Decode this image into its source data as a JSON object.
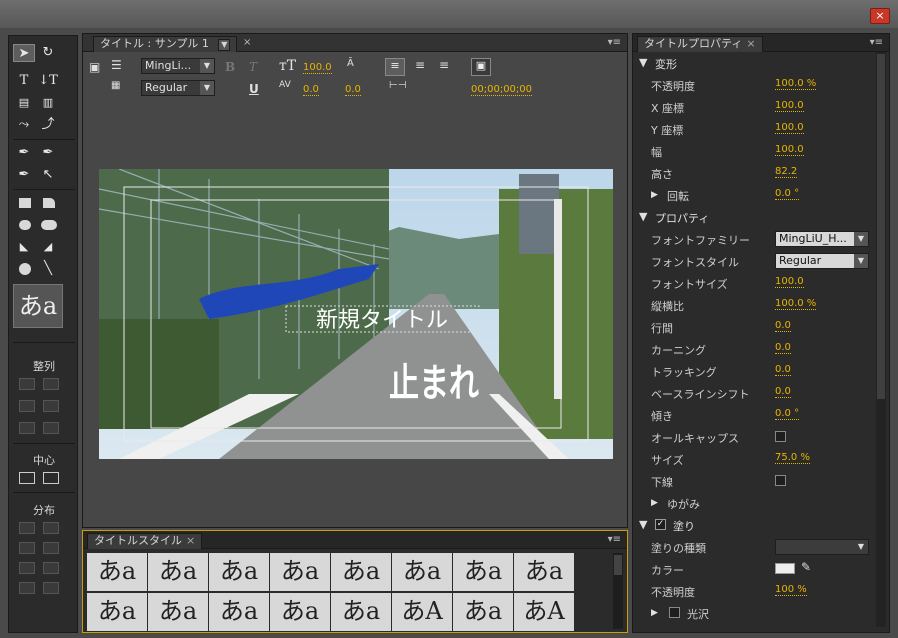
{
  "window": {
    "close_glyph": "×"
  },
  "tools": {
    "align_heading": "整列",
    "center_heading": "中心",
    "distribute_heading": "分布",
    "style_preview": "あa"
  },
  "designer": {
    "tab_label": "タイトル : サンプル 1",
    "font_family": "MingLi...",
    "font_style": "Regular",
    "font_size": "100.0",
    "kerning": "0.0",
    "leading": "0.0",
    "baseline": "0.0",
    "timecode": "00;00;00;00",
    "bold_glyph": "B",
    "italic_glyph": "T",
    "underline_glyph": "U",
    "canvas_title_text": "新規タイトル",
    "road_text": "止まれ"
  },
  "styles": {
    "tab_label": "タイトルスタイル",
    "swatches": [
      "あa",
      "あa",
      "あa",
      "あa",
      "あa",
      "あa",
      "あa",
      "あa",
      "あa",
      "あa",
      "あa",
      "あa",
      "あa",
      "あA",
      "あa",
      "あA"
    ]
  },
  "props": {
    "tab_label": "タイトルプロパティ",
    "sections": {
      "transform": "変形",
      "properties": "プロパティ",
      "fill": "塗り"
    },
    "rows": {
      "opacity": {
        "label": "不透明度",
        "value": "100.0 %"
      },
      "x": {
        "label": "X 座標",
        "value": "100.0"
      },
      "y": {
        "label": "Y 座標",
        "value": "100.0"
      },
      "width": {
        "label": "幅",
        "value": "100.0"
      },
      "height": {
        "label": "高さ",
        "value": "82.2"
      },
      "rotation": {
        "label": "回転",
        "value": "0.0 °"
      },
      "font_family": {
        "label": "フォントファミリー",
        "value": "MingLiU_H..."
      },
      "font_style": {
        "label": "フォントスタイル",
        "value": "Regular"
      },
      "font_size": {
        "label": "フォントサイズ",
        "value": "100.0"
      },
      "aspect": {
        "label": "縦横比",
        "value": "100.0 %"
      },
      "leading": {
        "label": "行間",
        "value": "0.0"
      },
      "kerning": {
        "label": "カーニング",
        "value": "0.0"
      },
      "tracking": {
        "label": "トラッキング",
        "value": "0.0"
      },
      "baseline_shift": {
        "label": "ベースラインシフト",
        "value": "0.0"
      },
      "slant": {
        "label": "傾き",
        "value": "0.0 °"
      },
      "all_caps": {
        "label": "オールキャップス"
      },
      "size": {
        "label": "サイズ",
        "value": "75.0 %"
      },
      "underline": {
        "label": "下線"
      },
      "distort": {
        "label": "ゆがみ"
      },
      "fill_type": {
        "label": "塗りの種類",
        "value": ""
      },
      "color": {
        "label": "カラー"
      },
      "fill_opacity": {
        "label": "不透明度",
        "value": "100 %"
      },
      "sheen": {
        "label": "光沢"
      }
    }
  },
  "colors": {
    "accent": "#e8b400",
    "panel": "#2b2b2b",
    "canvas_bg": "#474747"
  }
}
